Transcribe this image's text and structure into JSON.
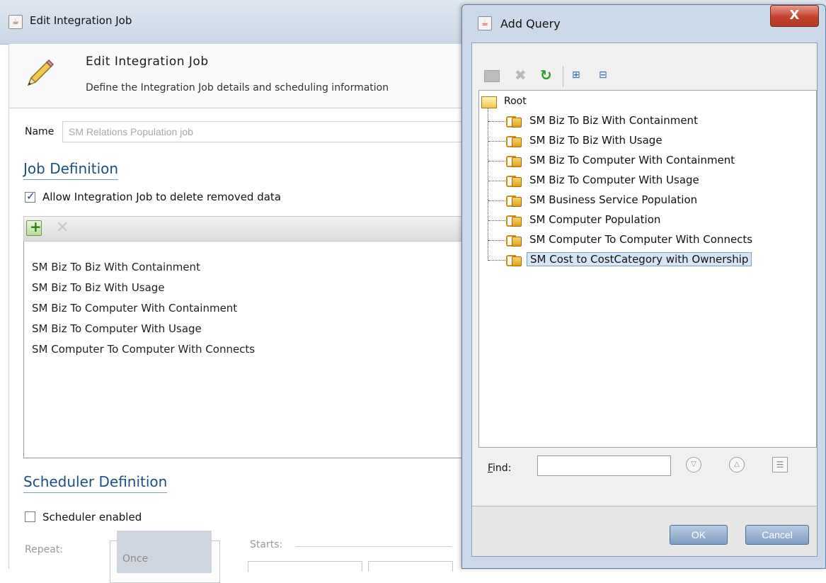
{
  "edit_dialog": {
    "window_title": "Edit Integration Job",
    "header_title": "Edit Integration Job",
    "header_subtitle": "Define the Integration Job details and scheduling information",
    "name_label": "Name",
    "name_value": "SM Relations Population job",
    "job_definition_title": "Job Definition",
    "allow_delete_label": "Allow Integration Job to delete removed data",
    "allow_delete_checked": true,
    "job_queries": [
      "SM Biz To Biz With Containment",
      "SM Biz To Biz With Usage",
      "SM Biz To Computer With Containment",
      "SM Biz To Computer With Usage",
      "SM Computer To Computer With Connects"
    ],
    "scheduler_definition_title": "Scheduler Definition",
    "scheduler_enabled_label": "Scheduler enabled",
    "scheduler_enabled_checked": false,
    "repeat_label": "Repeat:",
    "repeat_selected": "Once",
    "starts_label": "Starts:"
  },
  "add_query_dialog": {
    "window_title": "Add Query",
    "close_glyph": "X",
    "tree_root": "Root",
    "queries": [
      "SM Biz To Biz With Containment",
      "SM Biz To Biz With Usage",
      "SM Biz To Computer With Containment",
      "SM Biz To Computer With Usage",
      "SM Business Service Population",
      "SM Computer Population",
      "SM Computer To Computer With Connects",
      "SM Cost to CostCategory with Ownership"
    ],
    "selected_query": "SM Cost to CostCategory with Ownership",
    "find_label_first": "F",
    "find_label_rest": "ind:",
    "ok_label": "OK",
    "cancel_label": "Cancel"
  },
  "icons": {
    "java": "java-cup-icon",
    "edit": "pencil-icon",
    "folder": "folder-icon",
    "query": "query-icon",
    "refresh": "refresh-icon",
    "delete": "delete-icon",
    "add": "add-icon"
  },
  "colors": {
    "section_title": "#1d4f86",
    "title_bar": "#cbd9ea",
    "selection": "#d6e4f4",
    "close_button": "#c4412c"
  }
}
